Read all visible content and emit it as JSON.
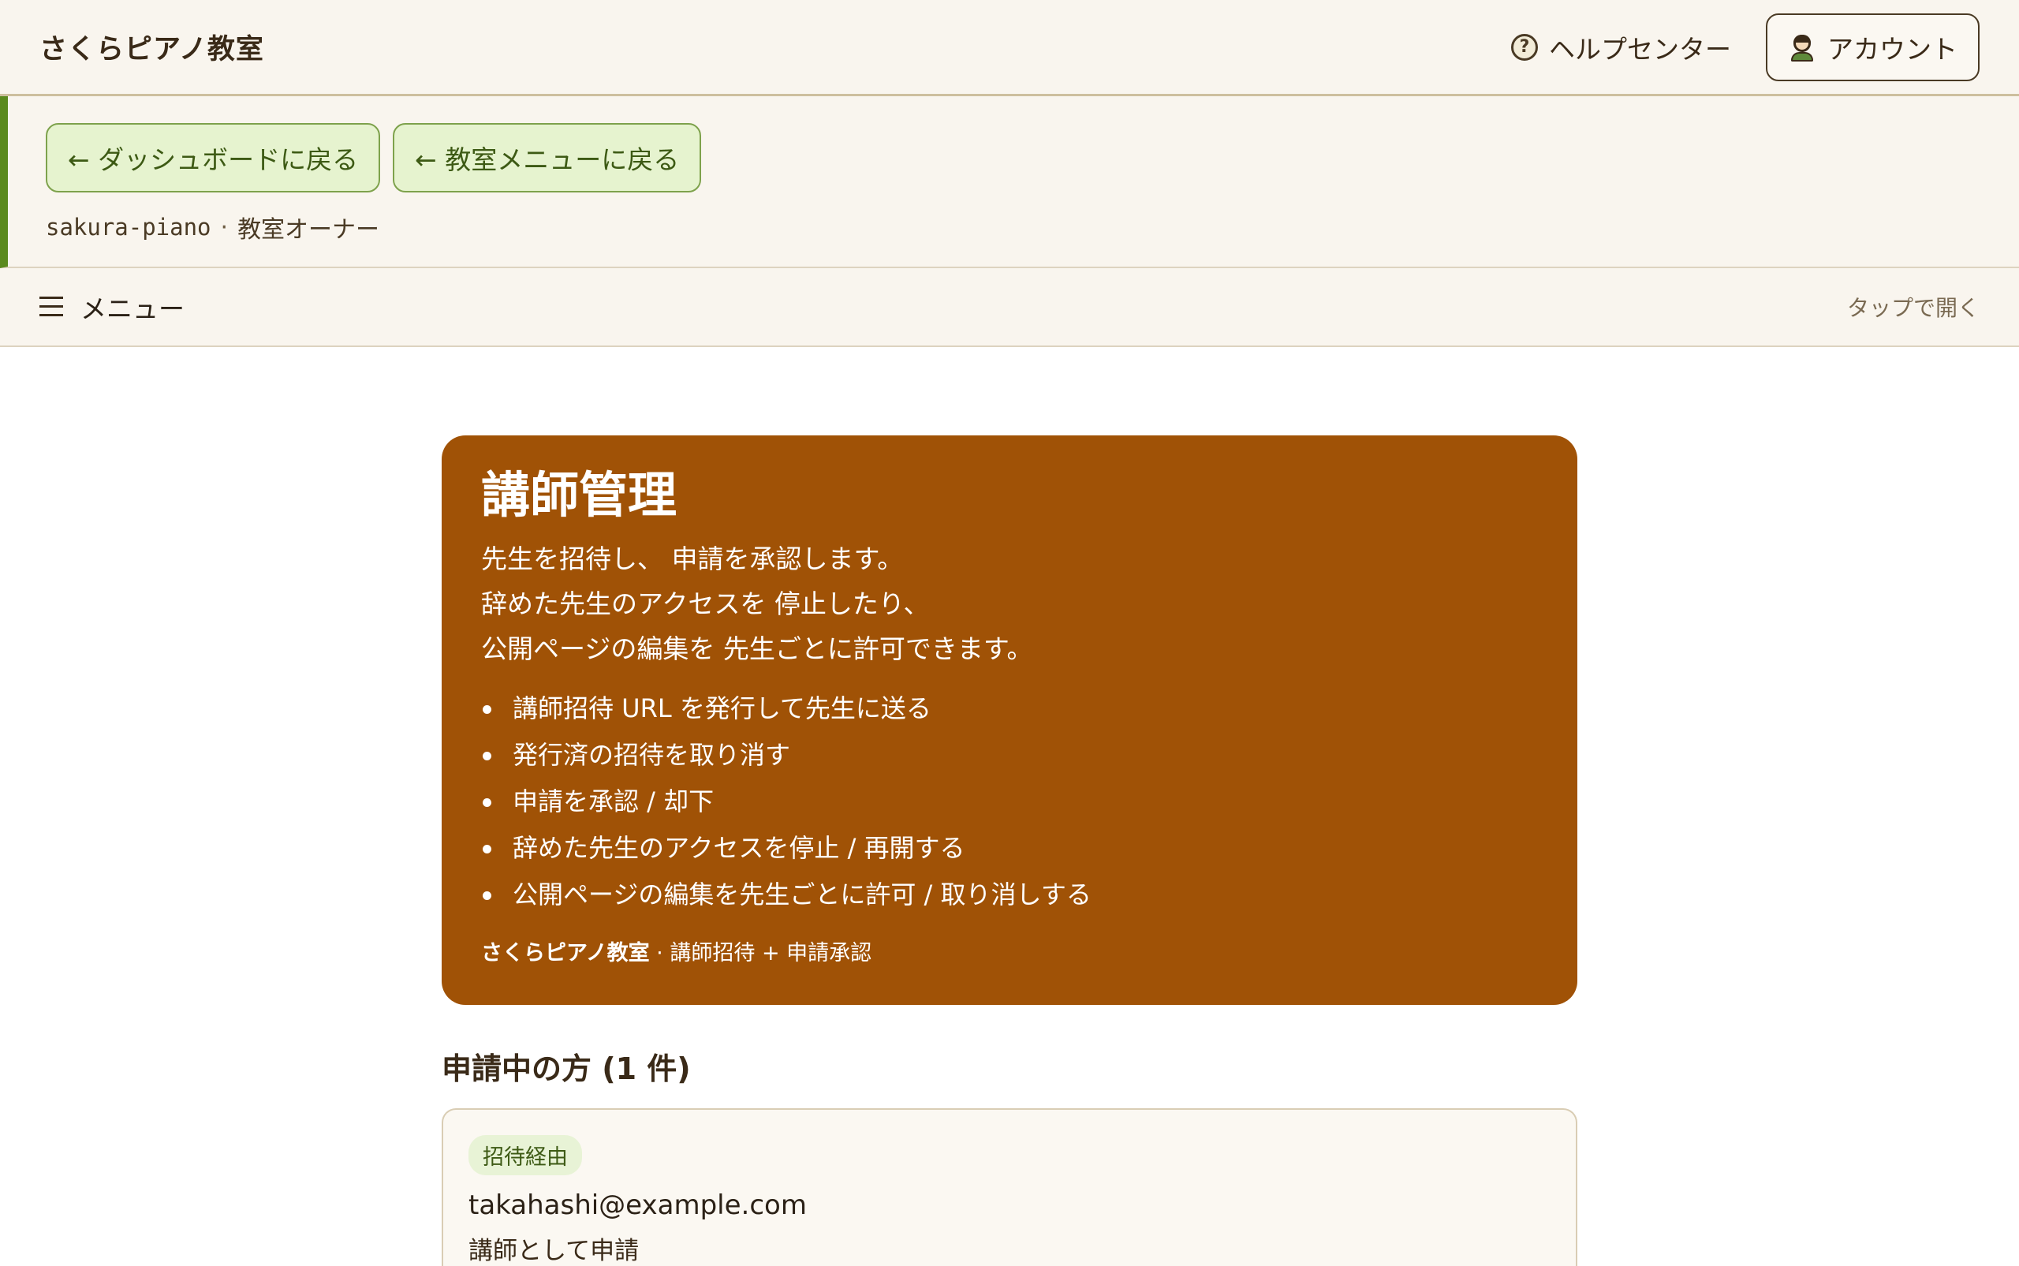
{
  "header": {
    "brand": "さくらピアノ教室",
    "help_label": "ヘルプセンター",
    "help_icon": "question-circle-icon",
    "account_label": "アカウント",
    "account_icon": "user-avatar-icon"
  },
  "subheader": {
    "back_dashboard": "← ダッシュボードに戻る",
    "back_menu": "← 教室メニューに戻る",
    "slug": "sakura-piano",
    "separator": "·",
    "role": "教室オーナー"
  },
  "menubar": {
    "label": "メニュー",
    "hint": "タップで開く"
  },
  "hero": {
    "title": "講師管理",
    "desc": [
      "先生を招待し、 申請を承認します。",
      "辞めた先生のアクセスを 停止したり、",
      "公開ページの編集を 先生ごとに許可できます。"
    ],
    "items": [
      "講師招待 URL を発行して先生に送る",
      "発行済の招待を取り消す",
      "申請を承認 / 却下",
      "辞めた先生のアクセスを停止 / 再開する",
      "公開ページの編集を先生ごとに許可 / 取り消しする"
    ],
    "footer_school": "さくらピアノ教室",
    "footer_sep": "·",
    "footer_text": "講師招待 + 申請承認"
  },
  "pending": {
    "title": "申請中の方 (1 件)",
    "applications": [
      {
        "badge": "招待経由",
        "email": "takahashi@example.com",
        "role": "講師として申請"
      }
    ]
  },
  "colors": {
    "hero_bg": "#a05206",
    "accent_green": "#5a8a1e",
    "button_bg": "#e6f3cf",
    "page_bg": "#f9f5ee"
  }
}
